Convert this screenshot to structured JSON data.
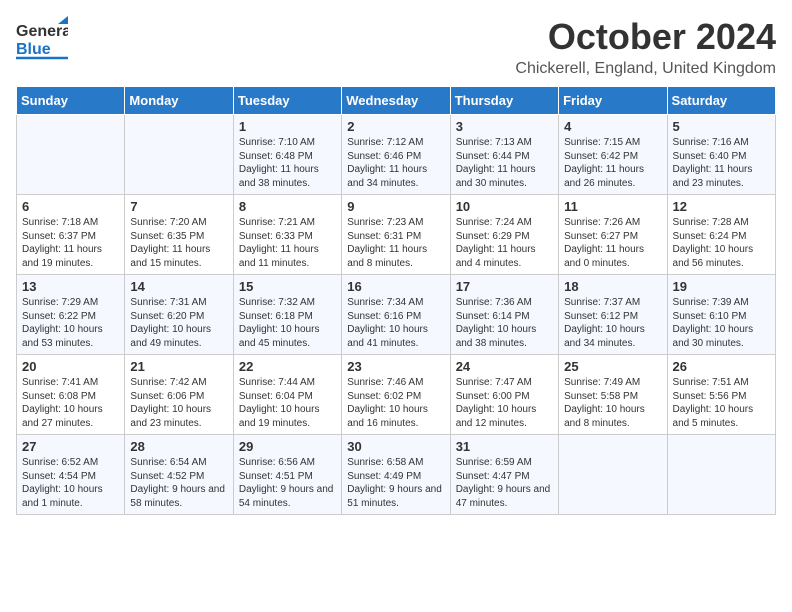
{
  "header": {
    "logo_general": "General",
    "logo_blue": "Blue",
    "month_title": "October 2024",
    "location": "Chickerell, England, United Kingdom"
  },
  "days_of_week": [
    "Sunday",
    "Monday",
    "Tuesday",
    "Wednesday",
    "Thursday",
    "Friday",
    "Saturday"
  ],
  "weeks": [
    [
      {
        "day": "",
        "text": ""
      },
      {
        "day": "",
        "text": ""
      },
      {
        "day": "1",
        "text": "Sunrise: 7:10 AM\nSunset: 6:48 PM\nDaylight: 11 hours and 38 minutes."
      },
      {
        "day": "2",
        "text": "Sunrise: 7:12 AM\nSunset: 6:46 PM\nDaylight: 11 hours and 34 minutes."
      },
      {
        "day": "3",
        "text": "Sunrise: 7:13 AM\nSunset: 6:44 PM\nDaylight: 11 hours and 30 minutes."
      },
      {
        "day": "4",
        "text": "Sunrise: 7:15 AM\nSunset: 6:42 PM\nDaylight: 11 hours and 26 minutes."
      },
      {
        "day": "5",
        "text": "Sunrise: 7:16 AM\nSunset: 6:40 PM\nDaylight: 11 hours and 23 minutes."
      }
    ],
    [
      {
        "day": "6",
        "text": "Sunrise: 7:18 AM\nSunset: 6:37 PM\nDaylight: 11 hours and 19 minutes."
      },
      {
        "day": "7",
        "text": "Sunrise: 7:20 AM\nSunset: 6:35 PM\nDaylight: 11 hours and 15 minutes."
      },
      {
        "day": "8",
        "text": "Sunrise: 7:21 AM\nSunset: 6:33 PM\nDaylight: 11 hours and 11 minutes."
      },
      {
        "day": "9",
        "text": "Sunrise: 7:23 AM\nSunset: 6:31 PM\nDaylight: 11 hours and 8 minutes."
      },
      {
        "day": "10",
        "text": "Sunrise: 7:24 AM\nSunset: 6:29 PM\nDaylight: 11 hours and 4 minutes."
      },
      {
        "day": "11",
        "text": "Sunrise: 7:26 AM\nSunset: 6:27 PM\nDaylight: 11 hours and 0 minutes."
      },
      {
        "day": "12",
        "text": "Sunrise: 7:28 AM\nSunset: 6:24 PM\nDaylight: 10 hours and 56 minutes."
      }
    ],
    [
      {
        "day": "13",
        "text": "Sunrise: 7:29 AM\nSunset: 6:22 PM\nDaylight: 10 hours and 53 minutes."
      },
      {
        "day": "14",
        "text": "Sunrise: 7:31 AM\nSunset: 6:20 PM\nDaylight: 10 hours and 49 minutes."
      },
      {
        "day": "15",
        "text": "Sunrise: 7:32 AM\nSunset: 6:18 PM\nDaylight: 10 hours and 45 minutes."
      },
      {
        "day": "16",
        "text": "Sunrise: 7:34 AM\nSunset: 6:16 PM\nDaylight: 10 hours and 41 minutes."
      },
      {
        "day": "17",
        "text": "Sunrise: 7:36 AM\nSunset: 6:14 PM\nDaylight: 10 hours and 38 minutes."
      },
      {
        "day": "18",
        "text": "Sunrise: 7:37 AM\nSunset: 6:12 PM\nDaylight: 10 hours and 34 minutes."
      },
      {
        "day": "19",
        "text": "Sunrise: 7:39 AM\nSunset: 6:10 PM\nDaylight: 10 hours and 30 minutes."
      }
    ],
    [
      {
        "day": "20",
        "text": "Sunrise: 7:41 AM\nSunset: 6:08 PM\nDaylight: 10 hours and 27 minutes."
      },
      {
        "day": "21",
        "text": "Sunrise: 7:42 AM\nSunset: 6:06 PM\nDaylight: 10 hours and 23 minutes."
      },
      {
        "day": "22",
        "text": "Sunrise: 7:44 AM\nSunset: 6:04 PM\nDaylight: 10 hours and 19 minutes."
      },
      {
        "day": "23",
        "text": "Sunrise: 7:46 AM\nSunset: 6:02 PM\nDaylight: 10 hours and 16 minutes."
      },
      {
        "day": "24",
        "text": "Sunrise: 7:47 AM\nSunset: 6:00 PM\nDaylight: 10 hours and 12 minutes."
      },
      {
        "day": "25",
        "text": "Sunrise: 7:49 AM\nSunset: 5:58 PM\nDaylight: 10 hours and 8 minutes."
      },
      {
        "day": "26",
        "text": "Sunrise: 7:51 AM\nSunset: 5:56 PM\nDaylight: 10 hours and 5 minutes."
      }
    ],
    [
      {
        "day": "27",
        "text": "Sunrise: 6:52 AM\nSunset: 4:54 PM\nDaylight: 10 hours and 1 minute."
      },
      {
        "day": "28",
        "text": "Sunrise: 6:54 AM\nSunset: 4:52 PM\nDaylight: 9 hours and 58 minutes."
      },
      {
        "day": "29",
        "text": "Sunrise: 6:56 AM\nSunset: 4:51 PM\nDaylight: 9 hours and 54 minutes."
      },
      {
        "day": "30",
        "text": "Sunrise: 6:58 AM\nSunset: 4:49 PM\nDaylight: 9 hours and 51 minutes."
      },
      {
        "day": "31",
        "text": "Sunrise: 6:59 AM\nSunset: 4:47 PM\nDaylight: 9 hours and 47 minutes."
      },
      {
        "day": "",
        "text": ""
      },
      {
        "day": "",
        "text": ""
      }
    ]
  ]
}
